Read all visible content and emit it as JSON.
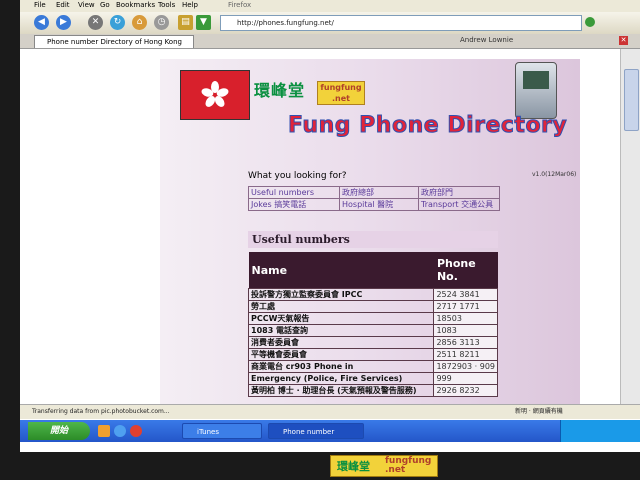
{
  "browser": {
    "window_title_fragment": "Firefox",
    "menu": [
      "File",
      "Edit",
      "View",
      "Go",
      "Bookmarks",
      "Tools",
      "Help"
    ],
    "address": "http://phones.fungfung.net/",
    "tab_title": "Phone number Directory of Hong Kong",
    "user_label": "Andrew Lownie",
    "status_text": "Transferring data from pic.photobucket.com...",
    "status_right": "新明 · 網頁續有機"
  },
  "page": {
    "logo_chinese": "環峰堂",
    "logo_brand": "fungfung",
    "logo_brand_tld": ".net",
    "title": "Fung Phone Directory",
    "version": "v1.0(12Mar06)",
    "question": "What you looking for?",
    "links": [
      [
        "Useful numbers",
        "政府總部",
        "政府部門"
      ],
      [
        "Jokes 搞笑電話",
        "Hospital 醫院",
        "Transport 交通公具"
      ]
    ],
    "section_title": "Useful numbers",
    "table": {
      "headers": [
        "Name",
        "Phone No."
      ],
      "rows": [
        {
          "name": "投訴警方獨立監察委員會 IPCC",
          "phone": "2524 3841"
        },
        {
          "name": "勞工處",
          "phone": "2717 1771"
        },
        {
          "name": "PCCW天氣報告",
          "phone": "18503"
        },
        {
          "name": "1083 電話查詢",
          "phone": "1083"
        },
        {
          "name": "消費者委員會",
          "phone": "2856 3113"
        },
        {
          "name": "平等機會委員會",
          "phone": "2511 8211"
        },
        {
          "name": "商業電台 cr903 Phone in",
          "phone": "1872903 · 909"
        },
        {
          "name": "Emergency (Police, Fire Services)",
          "phone": "999"
        },
        {
          "name": "黃明柏 博士 · 助理台長 (天氣預報及警告服務)",
          "phone": "2926 8232"
        }
      ]
    }
  },
  "taskbar": {
    "start_label": "開始",
    "tasks": [
      "iTunes",
      "Phone number Direct..."
    ]
  },
  "bezel": {
    "chinese": "環峰堂",
    "brand": "fungfung",
    "tld": ".net"
  }
}
